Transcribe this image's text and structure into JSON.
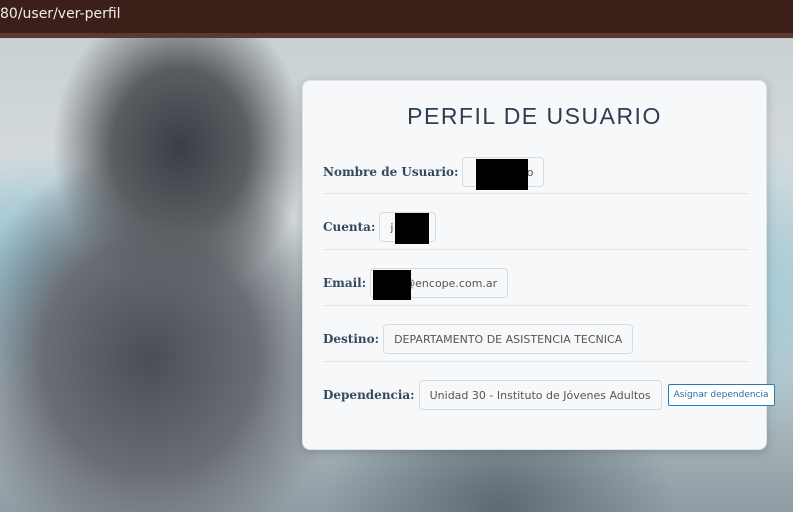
{
  "browser": {
    "url_fragment": "80/user/ver-perfil"
  },
  "profile": {
    "title": "PERFIL DE USUARIO",
    "fields": {
      "username": {
        "label": "Nombre de Usuario:",
        "value": "o"
      },
      "account": {
        "label": "Cuenta:",
        "value": "j"
      },
      "email": {
        "label": "Email:",
        "value": "o@encope.com.ar"
      },
      "destination": {
        "label": "Destino:",
        "value": "DEPARTAMENTO DE ASISTENCIA TECNICA"
      },
      "dependency": {
        "label": "Dependencia:",
        "value": "Unidad 30 - Instituto de Jóvenes Adultos"
      }
    },
    "assign_button": "Asignar dependencia"
  }
}
